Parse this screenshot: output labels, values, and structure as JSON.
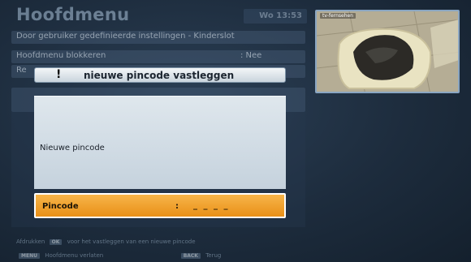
{
  "header": {
    "title": "Hoofdmenu",
    "clock": "Wo 13:53"
  },
  "menu": {
    "rows": [
      {
        "label": "Door gebruiker gedefinieerde instellingen - Kinderslot",
        "value": ""
      },
      {
        "label": "Hoofdmenu blokkeren",
        "value": ": Nee"
      },
      {
        "label": "Re",
        "value": ""
      }
    ]
  },
  "preview": {
    "label": "tv-fernsehen"
  },
  "dialog": {
    "icon": "exclamation-icon",
    "icon_glyph": "!",
    "title": "nieuwe pincode vastleggen",
    "body_label": "Nieuwe pincode",
    "pin_label": "Pincode",
    "pin_separator": ":",
    "pin_value": "_ _ _ _"
  },
  "footer": {
    "hint_prefix": "Afdrukken",
    "hint_key": "OK",
    "hint_text": "voor het vastleggen van een nieuwe pincode",
    "left_key": "MENU",
    "left_text": "Hoofdmenu verlaten",
    "right_key": "BACK",
    "right_text": "Terug"
  },
  "colors": {
    "background": "#1d2c3d",
    "highlight": "#e99017",
    "dialog_body": "#d3dde5"
  }
}
